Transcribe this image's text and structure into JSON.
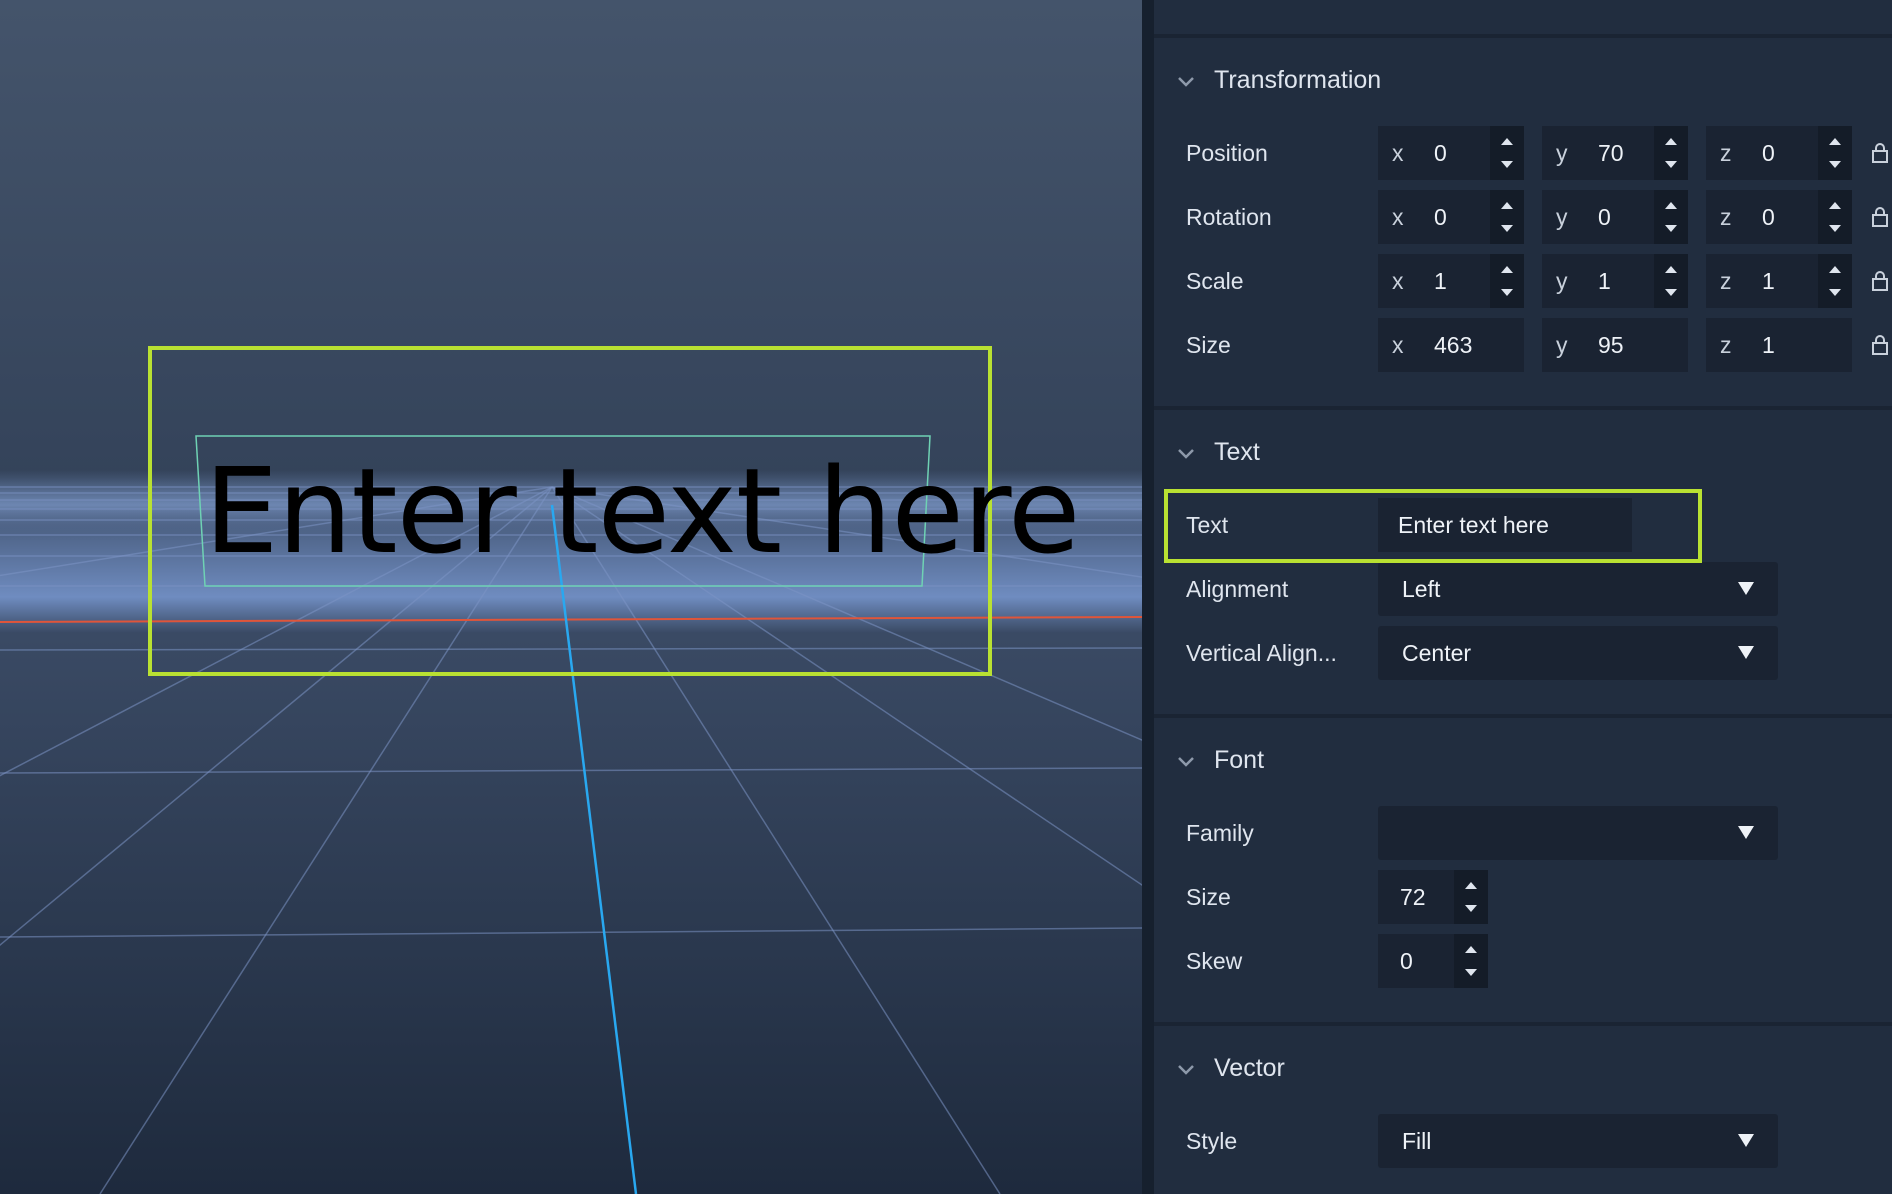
{
  "viewport": {
    "scene_text": "Enter text here"
  },
  "panel": {
    "transformation": {
      "header": "Transformation",
      "rows": [
        {
          "label": "Position",
          "x": "0",
          "y": "70",
          "z": "0"
        },
        {
          "label": "Rotation",
          "x": "0",
          "y": "0",
          "z": "0"
        },
        {
          "label": "Scale",
          "x": "1",
          "y": "1",
          "z": "1"
        },
        {
          "label": "Size",
          "x": "463",
          "y": "95",
          "z": "1"
        }
      ],
      "axis_labels": {
        "x": "x",
        "y": "y",
        "z": "z"
      }
    },
    "text": {
      "header": "Text",
      "text_label": "Text",
      "text_value": "Enter text here",
      "alignment_label": "Alignment",
      "alignment_value": "Left",
      "vertical_align_label": "Vertical Align...",
      "vertical_align_value": "Center"
    },
    "font": {
      "header": "Font",
      "family_label": "Family",
      "family_value": "",
      "size_label": "Size",
      "size_value": "72",
      "skew_label": "Skew",
      "skew_value": "0"
    },
    "vector": {
      "header": "Vector",
      "style_label": "Style",
      "style_value": "Fill"
    }
  },
  "colors": {
    "highlight": "#b9e132",
    "panel_bg": "#212d3f",
    "field_bg": "#1a2332",
    "axis_x": "#e0553a",
    "axis_y": "#29a8f0"
  }
}
